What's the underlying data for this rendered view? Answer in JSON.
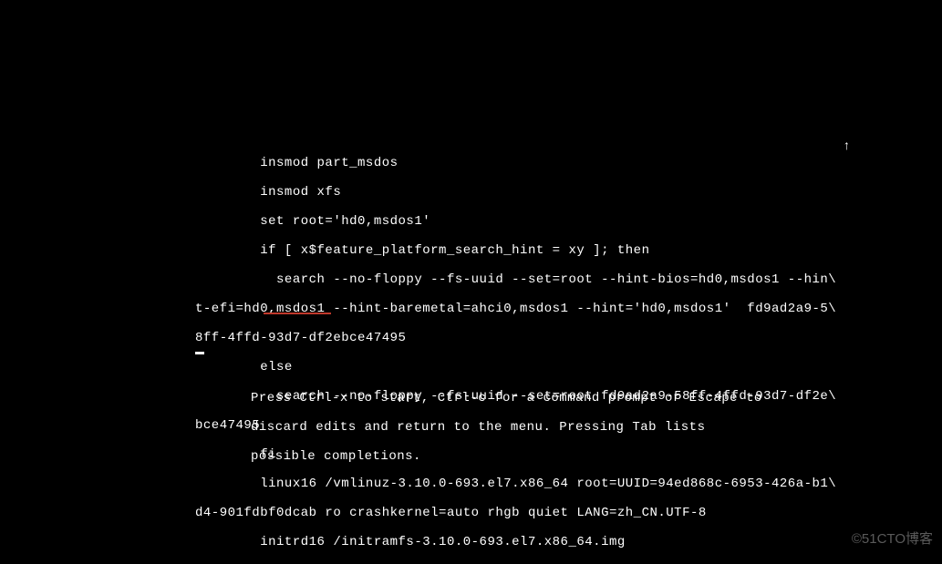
{
  "grub": {
    "lines": [
      "        insmod part_msdos",
      "        insmod xfs",
      "        set root='hd0,msdos1'",
      "        if [ x$feature_platform_search_hint = xy ]; then",
      "          search --no-floppy --fs-uuid --set=root --hint-bios=hd0,msdos1 --hin\\",
      "t-efi=hd0,msdos1 --hint-baremetal=ahci0,msdos1 --hint='hd0,msdos1'  fd9ad2a9-5\\",
      "8ff-4ffd-93d7-df2ebce47495",
      "        else",
      "          search --no-floppy --fs-uuid --set=root fd9ad2a9-58ff-4ffd-93d7-df2e\\",
      "bce47495",
      "        fi",
      "        linux16 /vmlinuz-3.10.0-693.el7.x86_64 root=UUID=94ed868c-6953-426a-b1\\",
      "d4-901fdbf0dcab ro crashkernel=auto rhgb quiet LANG=zh_CN.UTF-8",
      "        initrd16 /initramfs-3.10.0-693.el7.x86_64.img"
    ],
    "scroll_indicator": "↑",
    "help": [
      "Press Ctrl-x to start, Ctrl-c for a command prompt or Escape to",
      "discard edits and return to the menu. Pressing Tab lists",
      "possible completions."
    ]
  },
  "watermark": "©51CTO博客"
}
